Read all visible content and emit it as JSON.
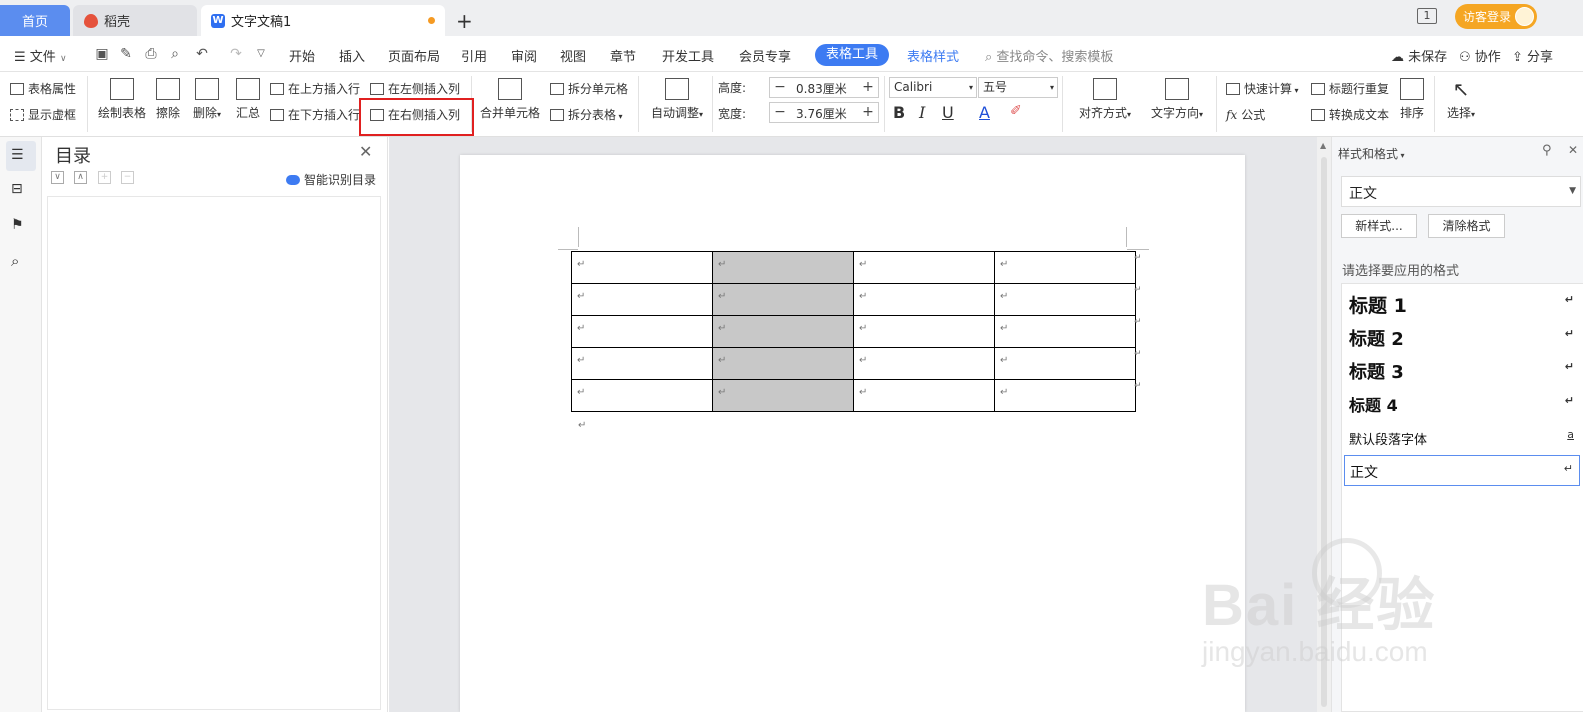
{
  "titlebar": {
    "tabs": [
      {
        "label": "首页"
      },
      {
        "label": "稻壳"
      },
      {
        "label": "文字文稿1"
      }
    ],
    "new_tab": "+",
    "window_mode_icon": "1",
    "visitor_login": "访客登录"
  },
  "menubar": {
    "file": "文件",
    "tabs": [
      "开始",
      "插入",
      "页面布局",
      "引用",
      "审阅",
      "视图",
      "章节",
      "开发工具",
      "会员专享",
      "表格工具",
      "表格样式"
    ],
    "search": "查找命令、搜索模板",
    "unsaved": "未保存",
    "collab": "协作",
    "share": "分享"
  },
  "ribbon": {
    "table_props": "表格属性",
    "show_gridlines": "显示虚框",
    "draw_table": "绘制表格",
    "erase": "擦除",
    "delete": "删除",
    "summary": "汇总",
    "insert_row_above": "在上方插入行",
    "insert_row_below": "在下方插入行",
    "insert_col_left": "在左侧插入列",
    "insert_col_right": "在右侧插入列",
    "merge_cells": "合并单元格",
    "split_cells": "拆分单元格",
    "split_table": "拆分表格",
    "auto_fit": "自动调整",
    "height_label": "高度:",
    "height_value": "0.83厘米",
    "width_label": "宽度:",
    "width_value": "3.76厘米",
    "font_name": "Calibri",
    "font_size": "五号",
    "bold": "B",
    "italic": "I",
    "underline": "U",
    "font_color": "A",
    "align": "对齐方式",
    "text_direction": "文字方向",
    "quick_calc": "快速计算",
    "formula": "公式",
    "repeat_header": "标题行重复",
    "convert_text": "转换成文本",
    "sort": "排序",
    "select": "选择"
  },
  "toc": {
    "title": "目录",
    "smart": "智能识别目录"
  },
  "document": {
    "table": {
      "rows": 5,
      "cols": 4,
      "shaded_col": 1,
      "cell_mark": "↵"
    },
    "para_mark": "↵"
  },
  "styles": {
    "title": "样式和格式",
    "current": "正文",
    "new_style": "新样式...",
    "clear_format": "清除格式",
    "hint": "请选择要应用的格式",
    "items": [
      {
        "label": "标题 1",
        "mark": "↵"
      },
      {
        "label": "标题 2",
        "mark": "↵"
      },
      {
        "label": "标题 3",
        "mark": "↵"
      },
      {
        "label": "标题 4",
        "mark": "↵"
      },
      {
        "label": "默认段落字体",
        "mark": "a"
      },
      {
        "label": "正文",
        "mark": "↵"
      }
    ]
  },
  "watermark": {
    "main": "Bai 经验",
    "sub": "jingyan.baidu.com"
  },
  "colors": {
    "accent": "#3d7bf2",
    "highlight_border": "#e02020",
    "visitor": "#f5a623",
    "shaded_cell": "#c8c8c8"
  }
}
